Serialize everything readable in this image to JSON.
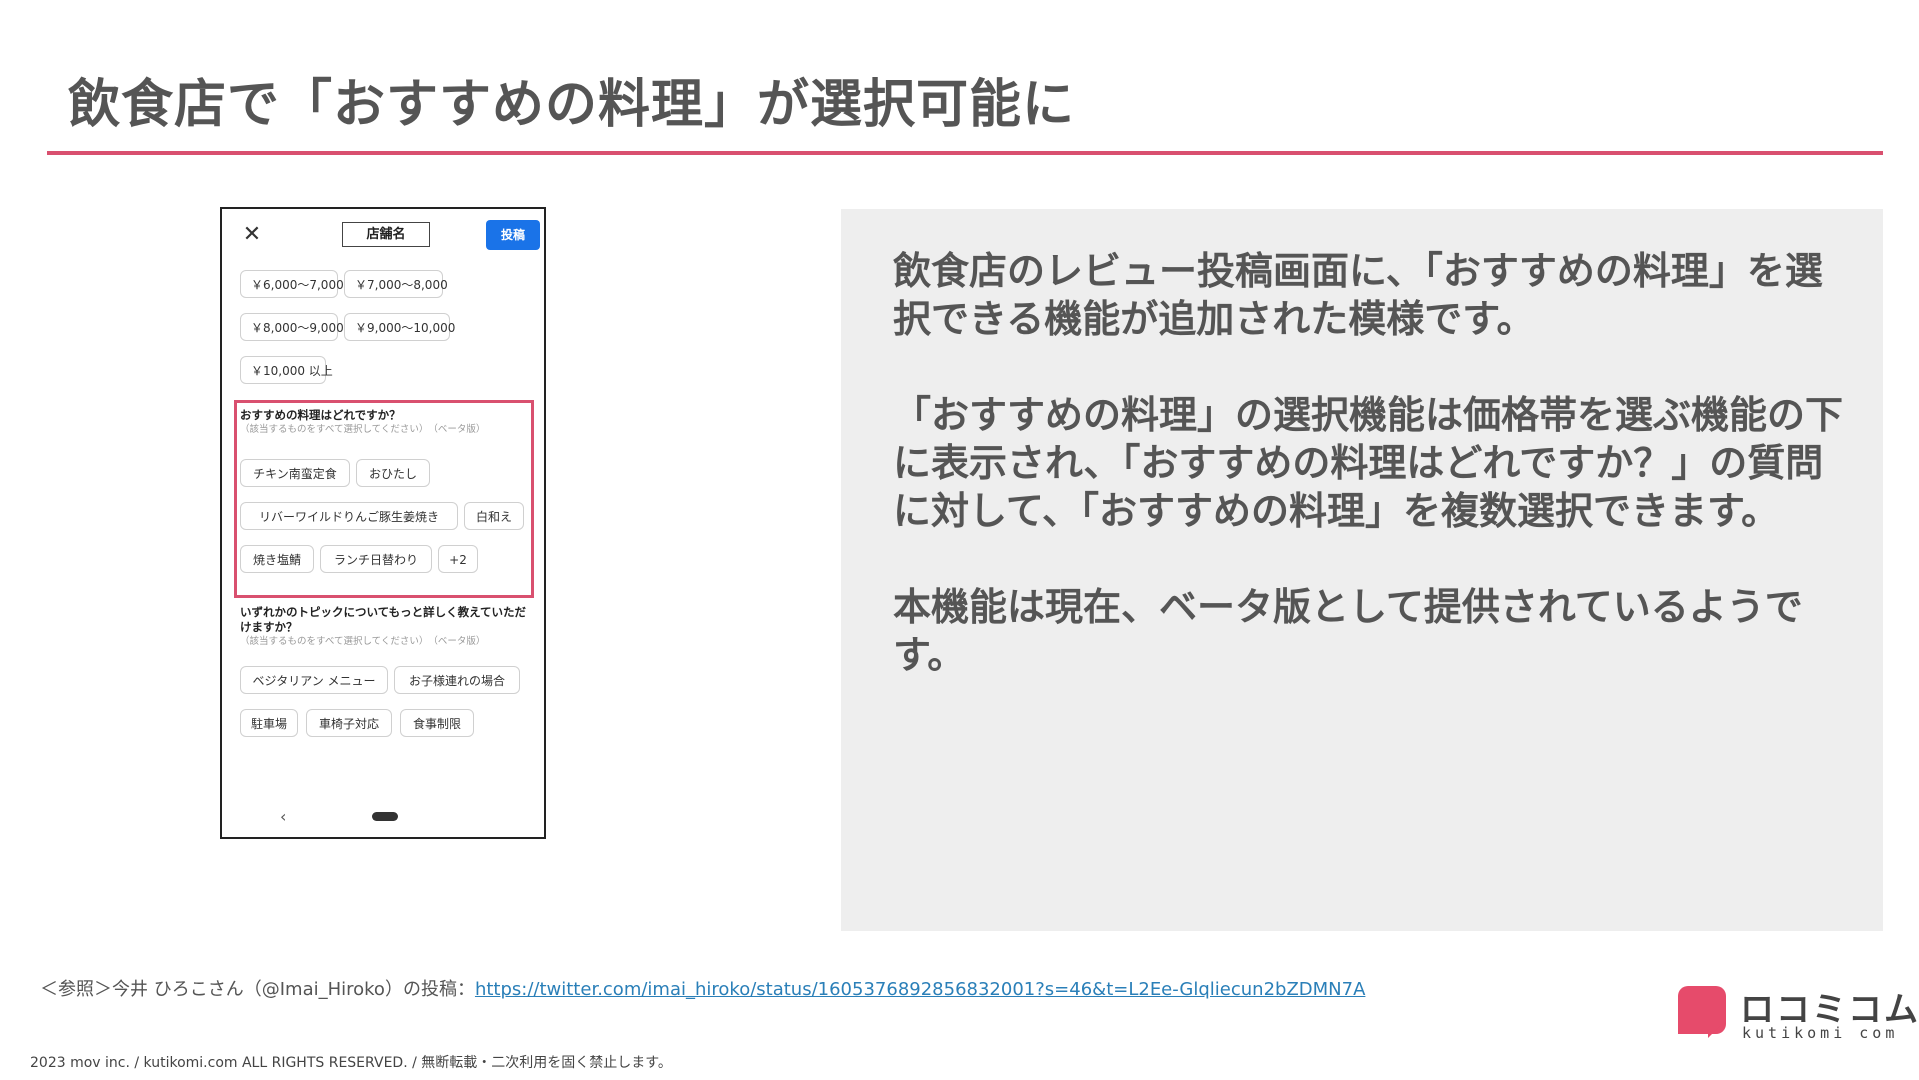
{
  "slide": {
    "title": "飲食店で「おすすめの料理」が選択可能に"
  },
  "phone": {
    "close_glyph": "✕",
    "shop_name": "店舗名",
    "post_button": "投稿",
    "price_chips": [
      "￥6,000～7,000",
      "￥7,000～8,000",
      "￥8,000～9,000",
      "￥9,000～10,000",
      "￥10,000 以上"
    ],
    "recommended_question": "おすすめの料理はどれですか？",
    "recommended_note": "（該当するものをすべて選択してください）　（ベータ版）",
    "recommended_chips": [
      "チキン南蛮定食",
      "おひたし",
      "リバーワイルドりんご豚生姜焼き",
      "白和え",
      "焼き塩鯖",
      "ランチ日替わり",
      "+2"
    ],
    "topic_question": "いずれかのトピックについてもっと詳しく教えていただけますか？",
    "topic_note": "（該当するものをすべて選択してください）　（ベータ版）",
    "topic_chips": [
      "ベジタリアン メニュー",
      "お子様連れの場合",
      "駐車場",
      "車椅子対応",
      "食事制限"
    ],
    "back_glyph": "‹"
  },
  "description": {
    "paragraph_1": "飲食店のレビュー投稿画面に、「おすすめの料理」を選択できる機能が追加された模様です。",
    "paragraph_2": "「おすすめの料理」の選択機能は価格帯を選ぶ機能の下に表示され、「おすすめの料理はどれですか？」の質問に対して、「おすすめの料理」を複数選択できます。",
    "paragraph_3": "本機能は現在、ベータ版として提供されているようです。"
  },
  "footer": {
    "reference_prefix": "＜参照＞今井 ひろこさん（@Imai_Hiroko）の投稿：",
    "reference_url": "https://twitter.com/imai_hiroko/status/1605376892856832001?s=46&t=L2Ee-Glqliecun2bZDMN7A",
    "copyright": "2023 mov inc. / kutikomi.com ALL RIGHTS RESERVED. / 無断転載・二次利用を固く禁止します。"
  },
  "logo": {
    "wordmark": "ロコミコム",
    "domain": "kutikomi com"
  },
  "colors": {
    "accent": "#d9506f",
    "logo": "#e64b6b",
    "post_button": "#1a73e8",
    "panel_bg": "#eeeeee",
    "link": "#2a7fb8"
  }
}
